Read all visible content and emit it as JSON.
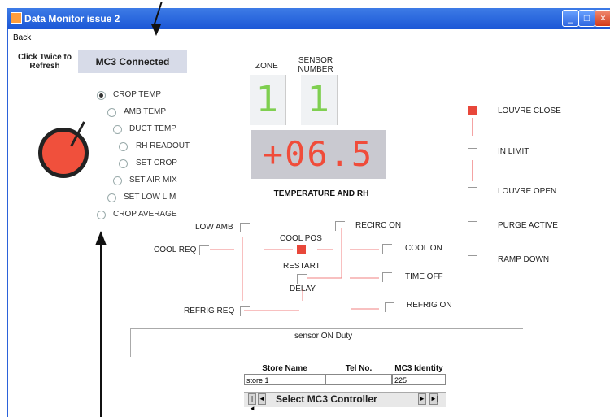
{
  "window": {
    "title": "Data Monitor issue 2"
  },
  "menu": {
    "back": "Back"
  },
  "refresh_hint": "Click Twice to Refresh",
  "connection_status": "MC3 Connected",
  "readout_modes": [
    "CROP TEMP",
    "AMB TEMP",
    "DUCT TEMP",
    "RH READOUT",
    "SET CROP",
    "SET AIR MIX",
    "SET LOW LIM",
    "CROP AVERAGE"
  ],
  "selected_mode": "CROP TEMP",
  "zone": {
    "label": "ZONE",
    "value": "1"
  },
  "sensor": {
    "label": "SENSOR NUMBER",
    "value": "1"
  },
  "temperature": {
    "value": "+06.5",
    "caption": "TEMPERATURE AND RH"
  },
  "status": {
    "louvre_close": "LOUVRE CLOSE",
    "in_limit": "IN LIMIT",
    "louvre_open": "LOUVRE OPEN",
    "purge_active": "PURGE ACTIVE",
    "ramp_down": "RAMP DOWN"
  },
  "logic": {
    "low_amb": "LOW AMB",
    "cool_req": "COOL REQ",
    "refrig_req": "REFRIG REQ",
    "cool_pos": "COOL POS",
    "restart": "RESTART",
    "delay": "DELAY",
    "recirc_on": "RECIRC ON",
    "cool_on": "COOL ON",
    "time_off": "TIME OFF",
    "refrig_on": "REFRIG ON"
  },
  "sensor_duty": "sensor ON Duty",
  "store_table": {
    "headers": [
      "Store Name",
      "Tel No.",
      "MC3 Identity"
    ],
    "row": [
      "store 1",
      "",
      "225"
    ]
  },
  "selector": {
    "label": "Select MC3 Controller"
  },
  "colors": {
    "titlebar": "#1b57d6",
    "indicator": "#e8473a",
    "digits_green": "#7fcf50",
    "temp_red": "#f04c3a"
  },
  "icons": {
    "nav_first": "skip-first-icon",
    "nav_prev": "prev-icon",
    "nav_next": "next-icon",
    "nav_last": "skip-last-icon"
  }
}
